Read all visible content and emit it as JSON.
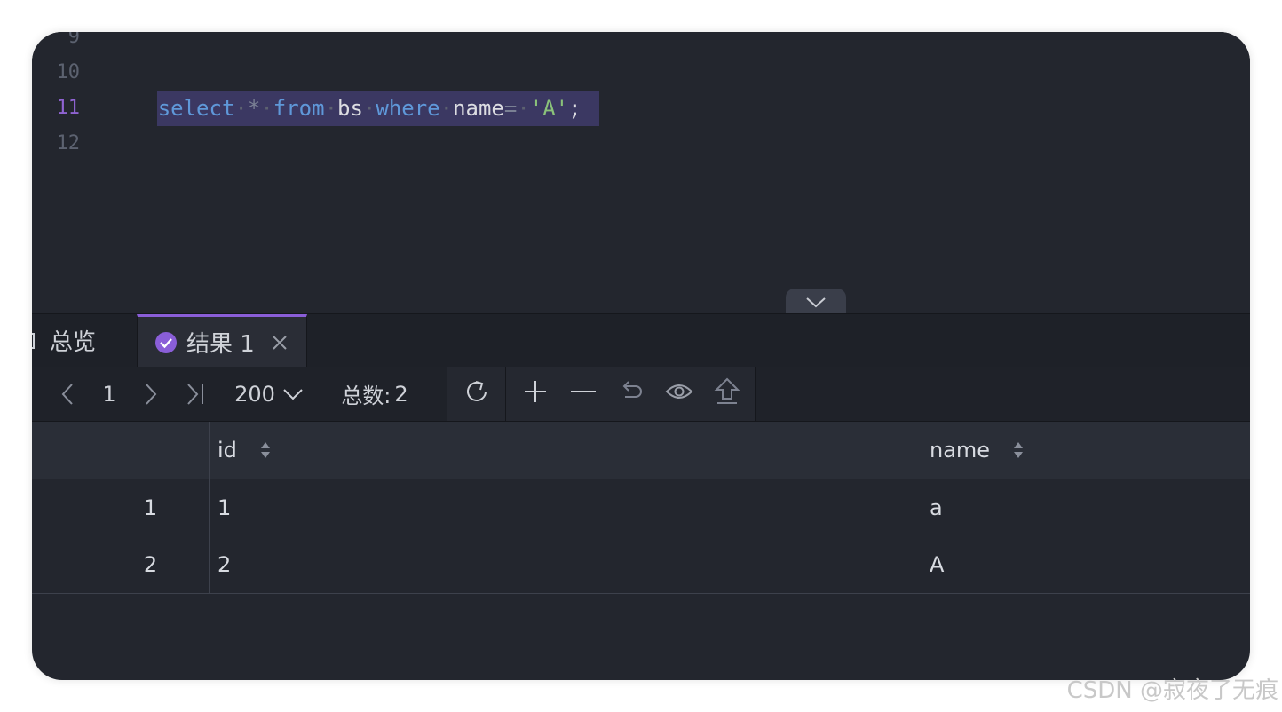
{
  "editor": {
    "line_numbers": [
      "9",
      "10",
      "11",
      "12"
    ],
    "active_line": "11",
    "code": {
      "kw_select": "select",
      "star": "*",
      "kw_from": "from",
      "table": "bs",
      "kw_where": "where",
      "column": "name",
      "eq": "=",
      "value": "'A'",
      "semicolon": ";"
    }
  },
  "tabs": {
    "overview": "总览",
    "result": "结果 1",
    "close": "✕"
  },
  "toolbar": {
    "page": "1",
    "page_size": "200",
    "total_label": "总数:",
    "total_value": "2"
  },
  "grid": {
    "columns": [
      "id",
      "name"
    ],
    "rows": [
      {
        "index": "1",
        "id": "1",
        "name": "a"
      },
      {
        "index": "2",
        "id": "2",
        "name": "A"
      }
    ]
  },
  "watermark": "CSDN @寂夜了无痕",
  "colors": {
    "background": "#23262e",
    "accent": "#8a5ed8",
    "keyword": "#5f98d9",
    "string": "#8ac27a",
    "selection": "#3b3862"
  }
}
